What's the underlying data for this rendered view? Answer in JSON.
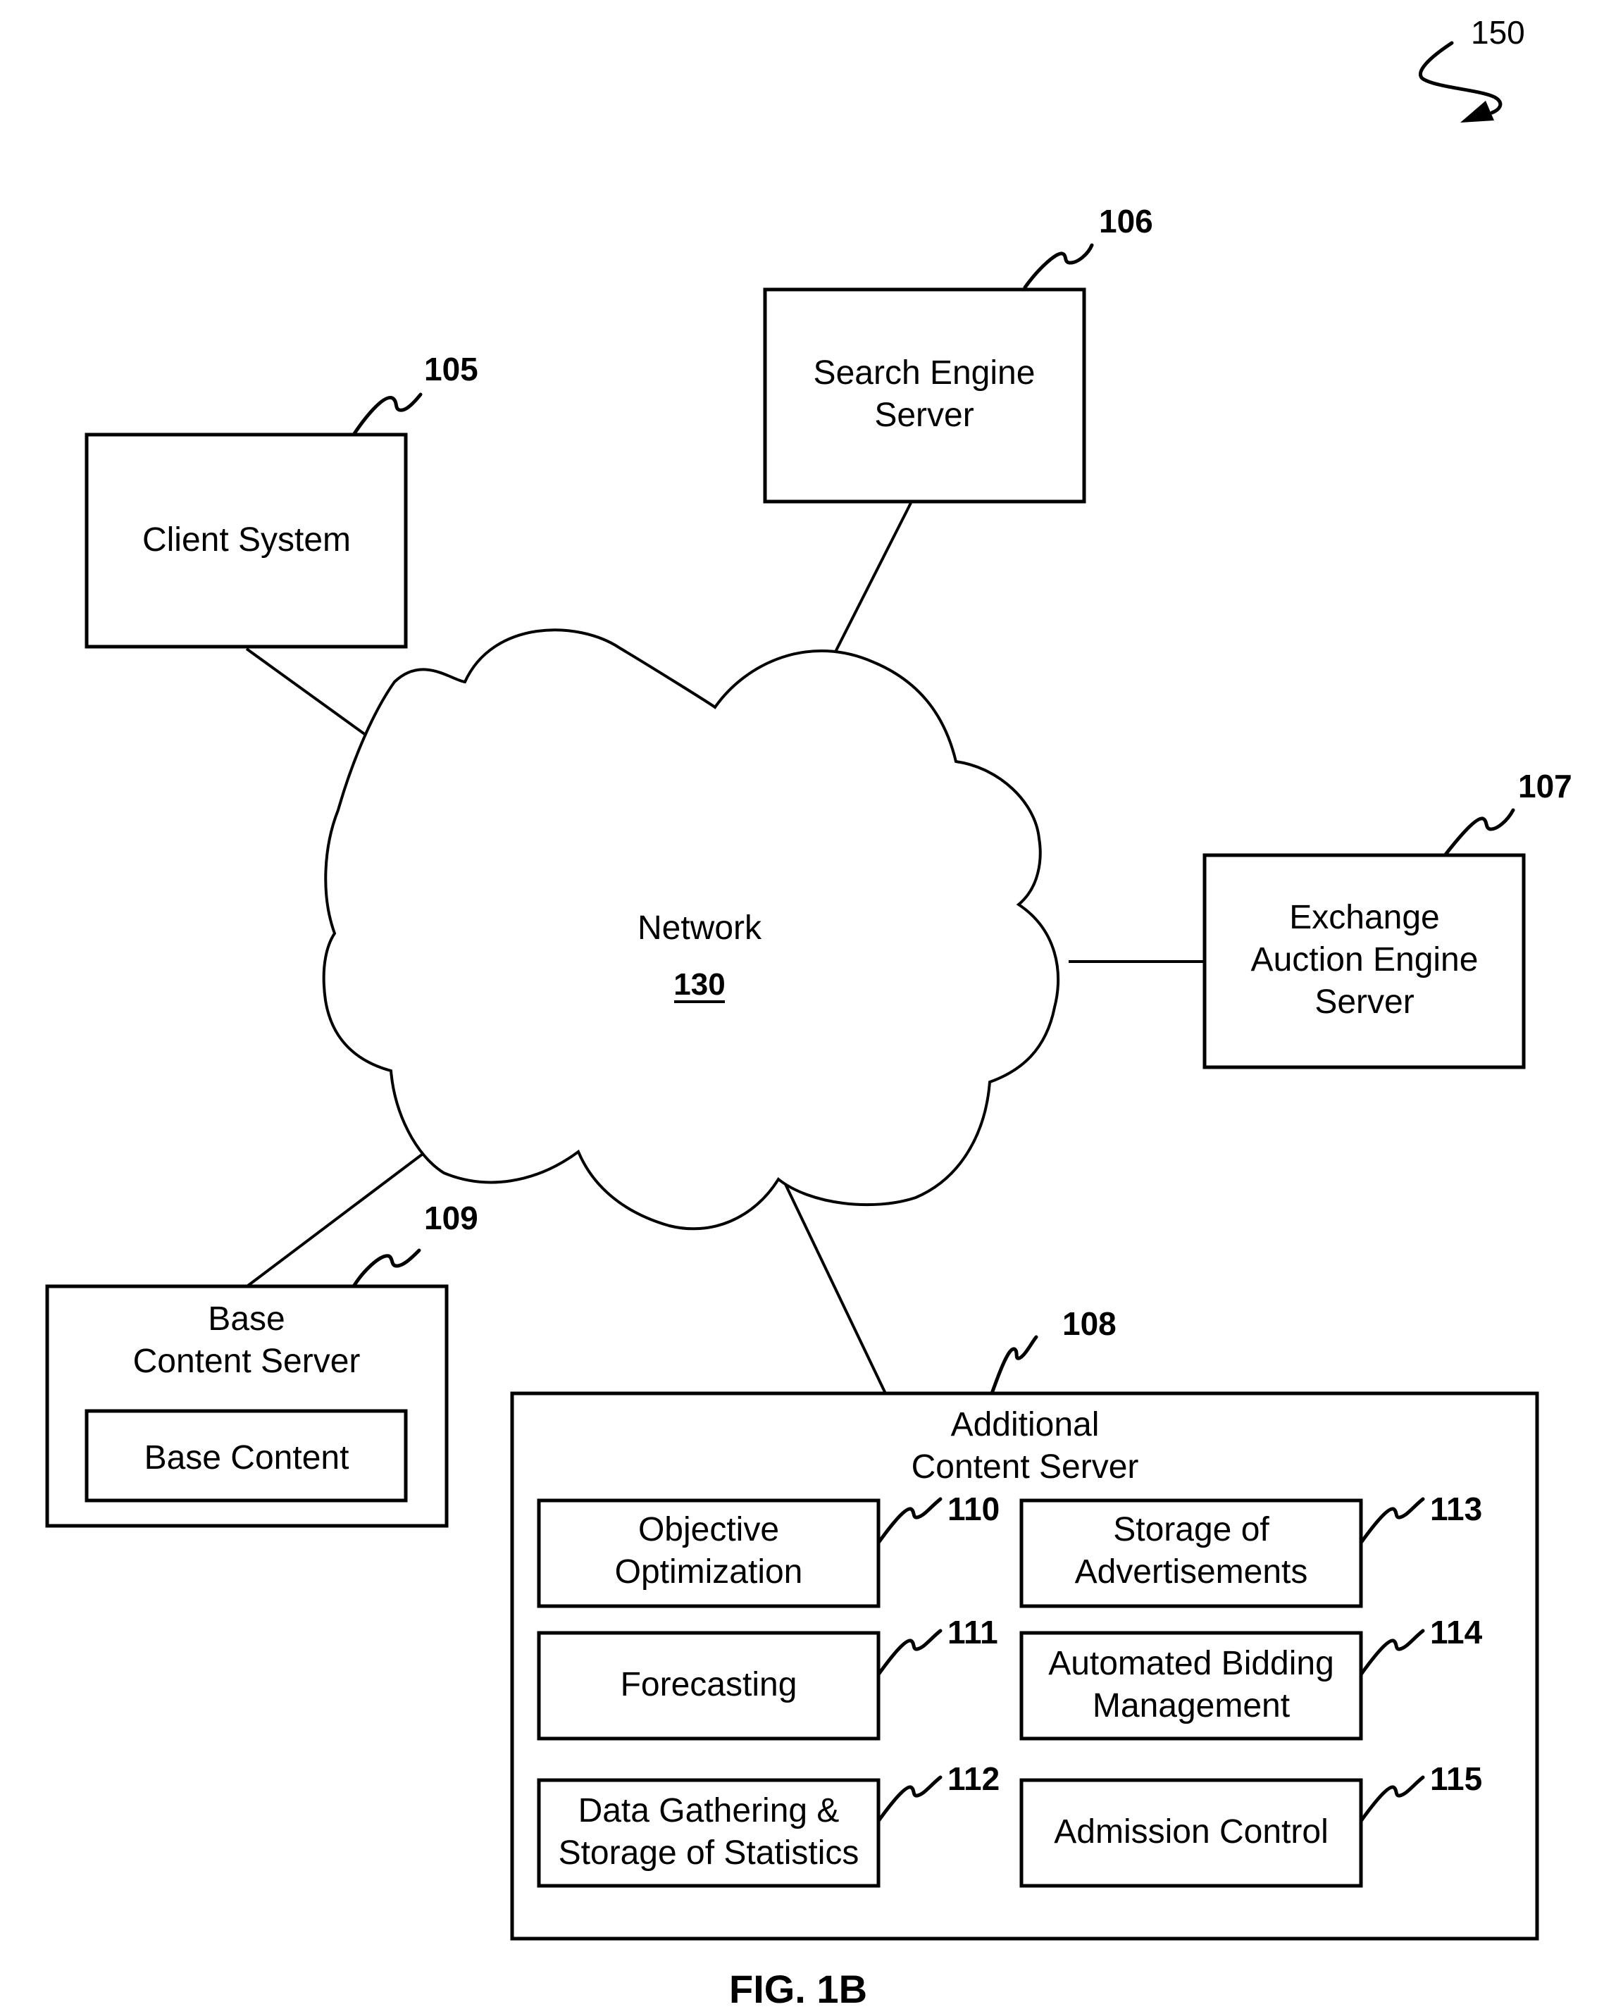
{
  "figure": {
    "caption": "FIG. 1B",
    "ref": "150"
  },
  "network": {
    "label": "Network",
    "ref": "130"
  },
  "nodes": {
    "client_system": {
      "lines": [
        "Client System"
      ],
      "ref": "105"
    },
    "search_engine_server": {
      "lines": [
        "Search Engine",
        "Server"
      ],
      "ref": "106"
    },
    "exchange_auction_engine_server": {
      "lines": [
        "Exchange",
        "Auction Engine",
        "Server"
      ],
      "ref": "107"
    },
    "base_content_server": {
      "lines": [
        "Base",
        "Content Server"
      ],
      "ref": "109",
      "inner": "Base Content"
    },
    "additional_content_server": {
      "lines": [
        "Additional",
        "Content Server"
      ],
      "ref": "108",
      "modules": [
        {
          "lines": [
            "Objective",
            "Optimization"
          ],
          "ref": "110"
        },
        {
          "lines": [
            "Forecasting"
          ],
          "ref": "111"
        },
        {
          "lines": [
            "Data Gathering &",
            "Storage of Statistics"
          ],
          "ref": "112"
        },
        {
          "lines": [
            "Storage of",
            "Advertisements"
          ],
          "ref": "113"
        },
        {
          "lines": [
            "Automated Bidding",
            "Management"
          ],
          "ref": "114"
        },
        {
          "lines": [
            "Admission Control"
          ],
          "ref": "115"
        }
      ]
    }
  }
}
